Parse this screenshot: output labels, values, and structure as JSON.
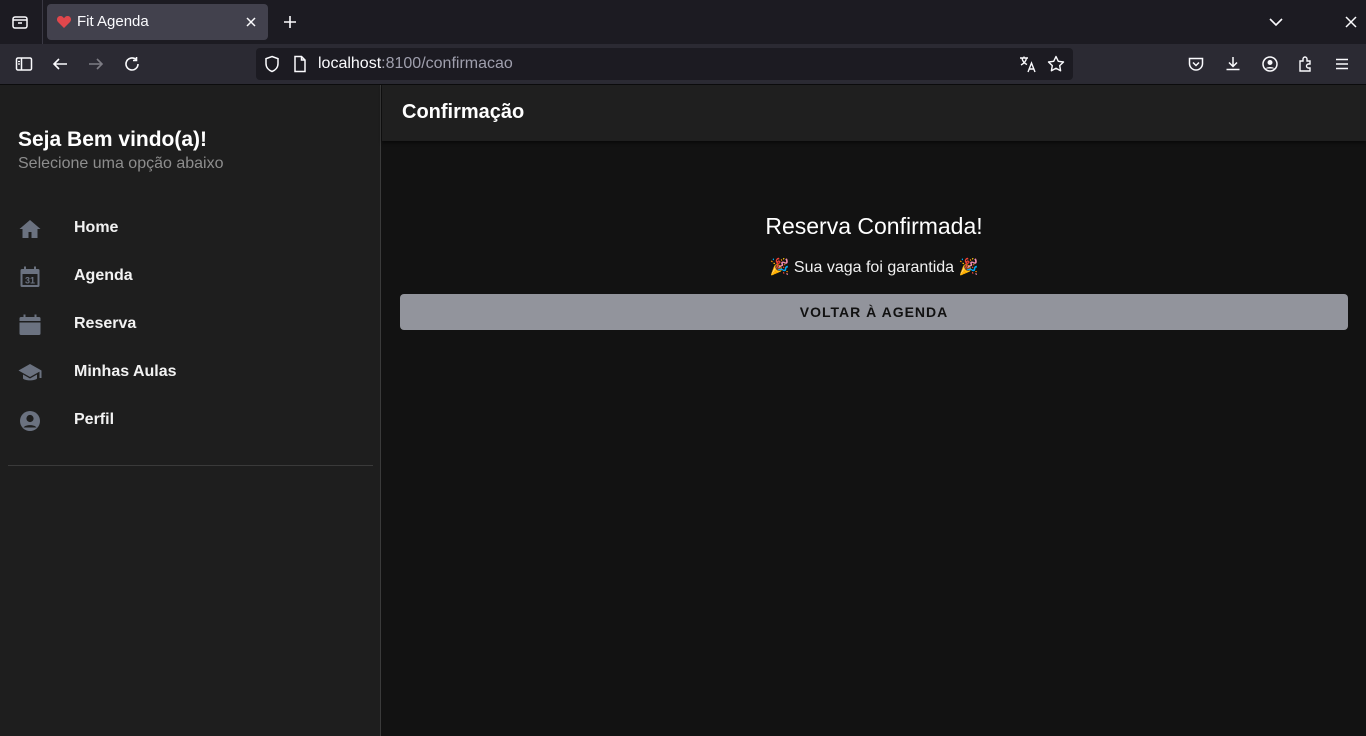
{
  "browser": {
    "tab_title": "Fit Agenda",
    "url_host": "localhost",
    "url_rest": ":8100/confirmacao"
  },
  "menu": {
    "title": "Seja Bem vindo(a)!",
    "subtitle": "Selecione uma opção abaixo",
    "items": [
      {
        "label": "Home",
        "icon": "home-icon"
      },
      {
        "label": "Agenda",
        "icon": "calendar-31-icon"
      },
      {
        "label": "Reserva",
        "icon": "calendar-icon"
      },
      {
        "label": "Minhas Aulas",
        "icon": "school-icon"
      },
      {
        "label": "Perfil",
        "icon": "person-circle-icon"
      }
    ]
  },
  "page": {
    "toolbar_title": "Confirmação",
    "heading": "Reserva Confirmada!",
    "message": "🎉 Sua vaga foi garantida 🎉",
    "button_label": "VOLTAR À AGENDA"
  },
  "colors": {
    "background": "#121212",
    "menu_background": "#1e1e1e",
    "button": "#92949c",
    "menu_icon": "#6b7280"
  }
}
